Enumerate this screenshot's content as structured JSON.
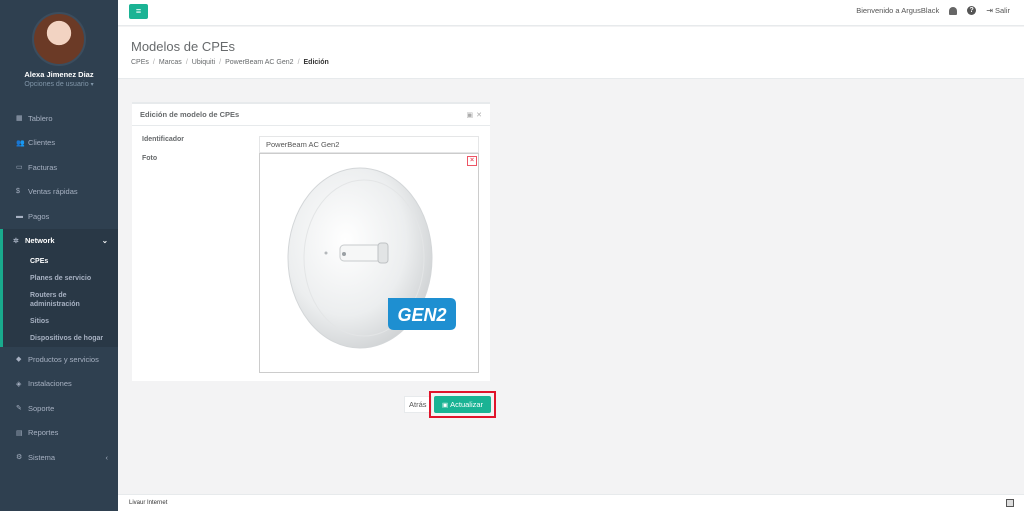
{
  "user": {
    "name": "Alexa Jimenez Diaz",
    "options_label": "Opciones de usuario"
  },
  "sidebar": {
    "items": [
      {
        "label": "Tablero",
        "icon": "dashboard-icon"
      },
      {
        "label": "Clientes",
        "icon": "users-icon"
      },
      {
        "label": "Facturas",
        "icon": "file-icon"
      },
      {
        "label": "Ventas rápidas",
        "icon": "dollar-icon"
      },
      {
        "label": "Pagos",
        "icon": "money-icon"
      }
    ],
    "network": {
      "label": "Network",
      "icon": "network-icon",
      "subitems": [
        "CPEs",
        "Planes de servicio",
        "Routers de administración",
        "Sitios",
        "Dispositivos de hogar"
      ]
    },
    "items_after": [
      {
        "label": "Productos y servicios",
        "icon": "tag-icon"
      },
      {
        "label": "Instalaciones",
        "icon": "location-icon"
      },
      {
        "label": "Soporte",
        "icon": "wrench-icon"
      },
      {
        "label": "Reportes",
        "icon": "book-icon"
      },
      {
        "label": "Sistema",
        "icon": "cogs-icon"
      }
    ]
  },
  "topbar": {
    "welcome": "Bienvenido a ArgusBlack",
    "logout_label": "Salir"
  },
  "page": {
    "title": "Modelos de CPEs",
    "breadcrumb": [
      "CPEs",
      "Marcas",
      "Ubiquiti",
      "PowerBeam AC Gen2",
      "Edición"
    ]
  },
  "panel": {
    "title": "Edición de modelo de CPEs",
    "identifier_label": "Identificador",
    "identifier_value": "PowerBeam AC Gen2",
    "photo_label": "Foto",
    "badge_text": "GEN2"
  },
  "actions": {
    "back_label": "Atrás",
    "update_label": "Actualizar"
  },
  "footer": {
    "text": "Livaur Internet"
  },
  "colors": {
    "sidebar_bg": "#2f4050",
    "accent": "#1ab394",
    "highlight_border": "#e0142b",
    "remove": "#ed5565"
  }
}
